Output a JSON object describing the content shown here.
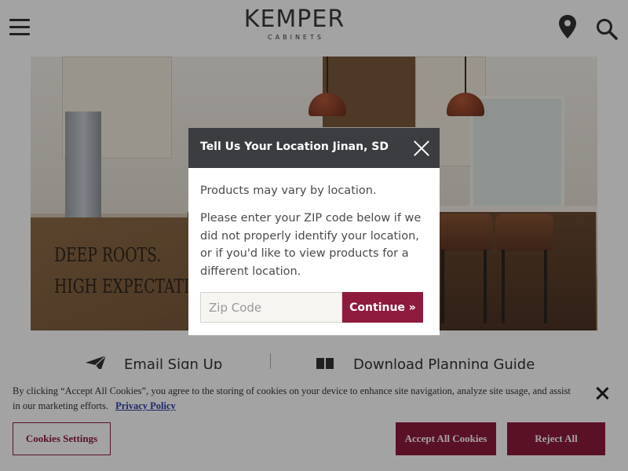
{
  "brand": {
    "name": "KEMPER",
    "sub": "CABINETS"
  },
  "header": {
    "menu_icon": "hamburger-menu-icon",
    "location_icon": "map-pin-icon",
    "search_icon": "search-icon"
  },
  "hero": {
    "tagline_line1": "DEEP ROOTS.",
    "tagline_line2": "HIGH EXPECTATIONS."
  },
  "below_row": {
    "email_label": "Email Sign Up",
    "guide_label": "Download Planning Guide"
  },
  "modal": {
    "title": "Tell Us Your Location Jinan, SD",
    "paragraph1": "Products may vary by location.",
    "paragraph2": "Please enter your ZIP code below if we did not properly identify your location, or if you'd like to view products for a different location.",
    "zip_placeholder": "Zip Code",
    "continue_label": "Continue »"
  },
  "cookie_banner": {
    "text": "By clicking “Accept All Cookies”, you agree to the storing of cookies on your device to enhance site navigation, analyze site usage, and assist in our marketing efforts.",
    "privacy_link": "Privacy Policy",
    "settings_label": "Cookies Settings",
    "accept_label": "Accept All Cookies",
    "reject_label": "Reject All"
  },
  "colors": {
    "accent": "#8e1b3c",
    "modal_header": "#3b3d40",
    "link": "#2b3ea8"
  }
}
